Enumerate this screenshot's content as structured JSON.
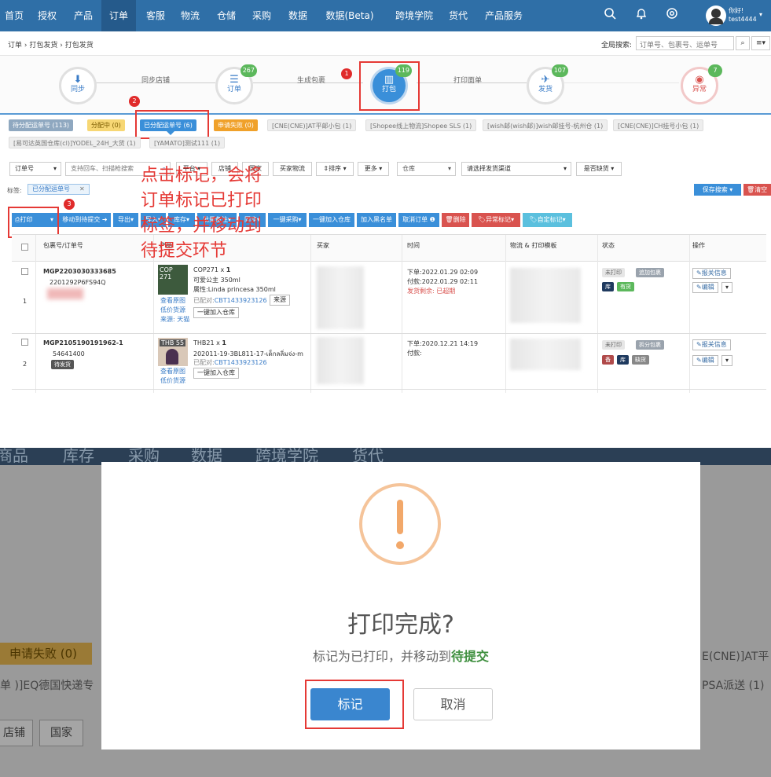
{
  "nav": {
    "items": [
      "首页",
      "授权",
      "产品",
      "订单",
      "客服",
      "物流",
      "仓储",
      "采购",
      "数据",
      "数据(Beta)",
      "跨境学院",
      "货代",
      "产品服务"
    ],
    "active_index": 3,
    "user_greeting": "你好!",
    "user_name": "test4444",
    "icons": [
      "search-icon",
      "bell-icon",
      "gear-icon"
    ]
  },
  "breadcrumb": {
    "items": [
      "订单",
      "打包发货",
      "打包发货"
    ]
  },
  "global_search": {
    "label": "全局搜索:",
    "placeholder": "订单号、包裹号、运单号"
  },
  "flow": {
    "nodes": [
      {
        "label": "同步",
        "badge": ""
      },
      {
        "label": "订单",
        "badge": "267"
      },
      {
        "label": "打包",
        "badge": "119"
      },
      {
        "label": "发货",
        "badge": "107"
      },
      {
        "label": "异常",
        "badge": "7"
      }
    ],
    "links": [
      "同步店铺",
      "生成包裹",
      "打印面单"
    ]
  },
  "steps": [
    "1",
    "2",
    "3"
  ],
  "status_tabs": [
    "待分配运单号 (113)",
    "分配中 (0)",
    "已分配运单号 (6)",
    "申请失败 (0)",
    "[CNE(CNE)]AT平邮小包 (1)",
    "[Shopee线上物流]Shopee SLS (1)",
    "[wish邮(wish邮)]wish邮挂号-杭州仓 (1)",
    "[CNE(CNE)]CH挂号小包 (1)",
    "[易可达英国仓库(cl)]YODEL_24H_大货 (1)",
    "[YAMATO]测试111 (1)"
  ],
  "filters": {
    "order_no_select": "订单号",
    "search_placeholder": "支持回车、扫描枪搜索",
    "platform": "平台",
    "shop": "店铺",
    "country": "国家",
    "buyer_logistics": "买家物流",
    "sort": "排序",
    "more": "更多",
    "warehouse": "仓库",
    "channel": "请选择发货渠道",
    "stock": "是否缺货",
    "save_search": "保存搜索",
    "clear": "清空"
  },
  "tag_filter": {
    "label": "标签:",
    "value": "已分配运单号"
  },
  "toolbar": {
    "print": "打印",
    "move_pending": "移动到待提交",
    "export": "导出",
    "import": "导入",
    "stock": "库存",
    "batch_note": "批量备注",
    "sync": "同步",
    "one_key_purchase": "一键采购",
    "add_warehouse": "一键加入仓库",
    "blacklist": "加入黑名单",
    "cancel_order": "取消订单",
    "delete": "删除",
    "abnormal_mark": "异常标记",
    "custom_mark": "自定标记"
  },
  "table": {
    "headers": [
      "包裹号/订单号",
      "产品",
      "买家",
      "时间",
      "物流 & 打印模板",
      "状态",
      "操作"
    ],
    "rows": [
      {
        "index": "1",
        "package_no": "MGP2203030333685",
        "order_no": "2201292P6FS94Q",
        "sku_thumb": "COP 271",
        "sku": "COP271 x ",
        "qty": "1",
        "name": "可爱公主 350ml",
        "attr": "属性:Linda princesa 350ml",
        "paired": "已配对:",
        "paired_code": "CBT1433923126",
        "source_btn": "来源",
        "add_wh": "一键加入仓库",
        "links": [
          "查看原图",
          "低价货源",
          "来源: 天猫"
        ],
        "time_order": "下单:2022.01.29 02:09",
        "time_pay": "付款:2022.01.29 02:11",
        "time_ship": "发货剩余: 已超期",
        "status1": "未打印",
        "status2": "追加包裹",
        "status3": "库",
        "status4": "有货",
        "op1": "报关信息",
        "op2": "编辑"
      },
      {
        "index": "2",
        "package_no": "MGP2105190191962-1",
        "order_no": "54641400",
        "pending": "待发货",
        "sku_thumb": "THB 55",
        "sku": "THB21 x ",
        "qty": "1",
        "name": "202011-19-3BL811-17-เด็กลลิ่มจ่ง-m",
        "paired": "已配对:",
        "paired_code": "CBT1433923126",
        "add_wh": "一键加入仓库",
        "links": [
          "查看原图",
          "低价货源"
        ],
        "time_order": "下单:2020.12.21 14:19",
        "time_pay": "付款:",
        "status1": "未打印",
        "status2": "拆分包裹",
        "status3": "备",
        "status4": "库",
        "status5": "缺货",
        "op1": "报关信息",
        "op2": "编辑"
      }
    ]
  },
  "bottom_bg": {
    "nav": [
      "商品",
      "库存",
      "采购",
      "数据",
      "跨境学院",
      "货代"
    ],
    "tab": "申请失败 (0)",
    "left_text": "单 )]EQ德国快递专",
    "right_top": "E(CNE)]AT平",
    "right_bottom": "PSA派送 (1)",
    "shop": "店铺",
    "country": "国家"
  },
  "modal": {
    "title": "打印完成?",
    "message": "标记为已打印，并移动到",
    "message_highlight": "待提交",
    "confirm": "标记",
    "cancel": "取消",
    "icon": "warning-circle-icon"
  },
  "annotation": {
    "lines": [
      "点击标记，会将",
      "订单标记已打印",
      "标签，并移动到",
      "待提交环节"
    ]
  },
  "colors": {
    "nav": "#2f6fa7",
    "accent": "#3a8fd9",
    "warning": "#f0ad72",
    "annotation": "#e53935"
  }
}
